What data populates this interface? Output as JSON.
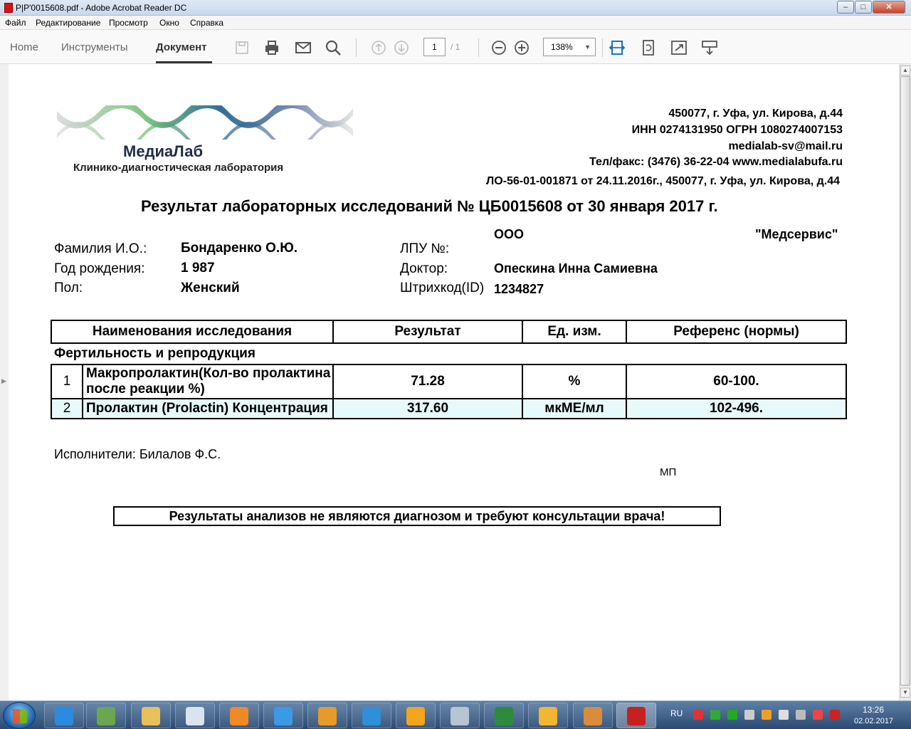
{
  "window": {
    "title": "P|P'0015608.pdf - Adobe Acrobat Reader DC",
    "minimize": "–",
    "maximize": "□",
    "close": "✕"
  },
  "menu": [
    "Файл",
    "Редактирование",
    "Просмотр",
    "Окно",
    "Справка"
  ],
  "toolbar": {
    "tabs": [
      "Home",
      "Инструменты",
      "Документ"
    ],
    "active_tab": "Документ",
    "page_current": "1",
    "page_total": "/ 1",
    "zoom": "138%",
    "icons": [
      "save-icon",
      "print-icon",
      "email-icon",
      "search-icon",
      "page-up-icon",
      "page-down-icon",
      "zoom-out-icon",
      "zoom-in-icon",
      "fit-width-icon",
      "rotate-icon",
      "fullscreen-icon",
      "read-mode-icon"
    ]
  },
  "document": {
    "lab_name": "МедиаЛаб",
    "lab_subtitle": "Клинико-диагностическая лаборатория",
    "address": "450077, г. Уфа, ул. Кирова, д.44",
    "inn": "ИНН  0274131950 ОГРН  1080274007153",
    "email": "medialab-sv@mail.ru",
    "phone": "Тел/факс: (3476) 36-22-04 www.medialabufa.ru",
    "license": "ЛО-56-01-001871 от 24.11.2016г.,  450077, г. Уфа, ул. Кирова, д.44",
    "title": "Результат лабораторных исследований № ЦБ0015608 от 30 января 2017 г.",
    "patient": {
      "name_label": "Фамилия И.О.:",
      "name": "Бондаренко  О.Ю.",
      "birth_label": "Год рождения:",
      "birth": "1 987",
      "sex_label": "Пол:",
      "sex": "Женский"
    },
    "clinic": {
      "lpu_label": "ЛПУ №:",
      "lpu_prefix": "ООО",
      "lpu_name": "\"Медсервис\"",
      "doctor_label": "Доктор:",
      "doctor": "Опескина Инна Самиевна",
      "barcode_label": "Штрихкод(ID)",
      "barcode": "1234827"
    },
    "table": {
      "headers": [
        "Наименования исследования",
        "Результат",
        "Ед. изм.",
        "Референс (нормы)"
      ],
      "section": "Фертильность и репродукция",
      "rows": [
        {
          "num": "1",
          "name": "Макропролактин(Кол-во пролактина после реакции %)",
          "result": "71.28",
          "unit": "%",
          "ref": "60-100."
        },
        {
          "num": "2",
          "name": "Пролактин (Prolactin) Концентрация",
          "result": "317.60",
          "unit": "мкМЕ/мл",
          "ref": "102-496."
        }
      ]
    },
    "performers": "Исполнители:  Билалов  Ф.С.",
    "stamp": "МП",
    "disclaimer": "Результаты анализов не являются диагнозом и требуют консультации врача!"
  },
  "taskbar": {
    "language": "RU",
    "time": "13:26",
    "date": "02.02.2017"
  }
}
